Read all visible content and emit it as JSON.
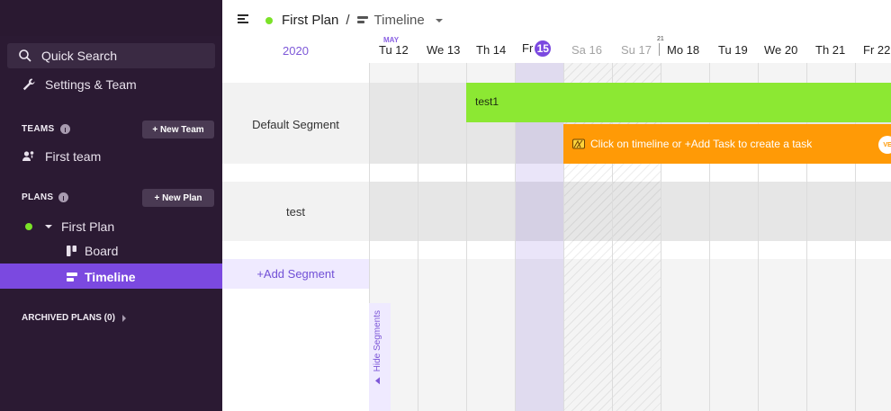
{
  "sidebar": {
    "quick_search": "Quick Search",
    "settings": "Settings & Team",
    "teams_label": "TEAMS",
    "new_team": "+ New Team",
    "first_team": "First team",
    "plans_label": "PLANS",
    "new_plan": "+ New Plan",
    "first_plan": "First Plan",
    "board": "Board",
    "timeline": "Timeline",
    "archived": "ARCHIVED PLANS (0)"
  },
  "header": {
    "plan": "First Plan",
    "separator": "/",
    "view": "Timeline"
  },
  "dates": {
    "year": "2020",
    "month": "MAY",
    "week_number": "21",
    "days": [
      "Tu 12",
      "We 13",
      "Th 14",
      "Fr",
      "Sa 16",
      "Su 17",
      "Mo 18",
      "Tu 19",
      "We 20",
      "Th 21",
      "Fr 22"
    ],
    "today_number": "15"
  },
  "segments": {
    "default": "Default Segment",
    "test": "test",
    "add": "+Add Segment",
    "hide": "Hide Segments"
  },
  "tasks": {
    "green": "test1",
    "orange": "Click on timeline or +Add Task to create a task",
    "badge": "VE"
  },
  "colors": {
    "accent": "#7b49e0",
    "sidebar": "#2b1a33",
    "green_task": "#8ce833",
    "orange_task": "#ff9a06"
  }
}
